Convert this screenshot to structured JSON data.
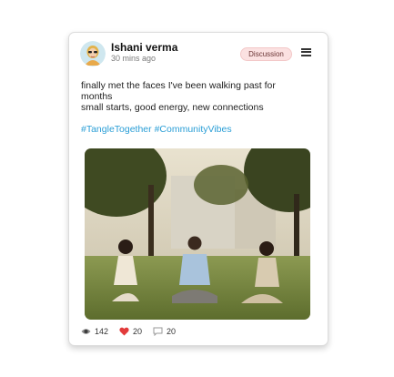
{
  "post": {
    "author": "Ishani verma",
    "time": "30 mins ago",
    "category": "Discussion",
    "lines": [
      "finally met the faces I've been walking past for",
      "months",
      "small starts, good energy, new connections"
    ],
    "hashtags": [
      "#TangleTogether",
      "#CommunityVibes"
    ]
  },
  "stats": {
    "views": "142",
    "likes": "20",
    "comments": "20"
  },
  "colors": {
    "hashtag": "#2a9ed6",
    "tag_bg": "#fbe1e1",
    "like": "#e23b3b"
  },
  "icons": {
    "views": "eye-icon",
    "likes": "heart-icon",
    "comments": "comment-icon",
    "menu": "hamburger-menu-icon"
  }
}
